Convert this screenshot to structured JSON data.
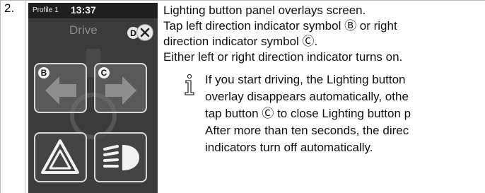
{
  "step": {
    "number": "2."
  },
  "screen": {
    "profile": "Profile 1",
    "time": "13:37",
    "title": "Drive",
    "callouts": {
      "b": "B",
      "c": "C",
      "d": "D"
    },
    "colors": {
      "background": "#3b3b3b",
      "topbar": "#1f1f1f",
      "button_border": "#d9d9d9"
    }
  },
  "instructions": [
    "Lighting button panel overlays screen.",
    "Tap left direction indicator symbol Ⓑ or right",
    "direction indicator symbol Ⓒ.",
    "Either left or right direction indicator turns on."
  ],
  "note": {
    "icon": "info-icon",
    "lines": [
      "If you start driving, the Lighting button",
      "overlay disappears automatically, othe",
      "tap button Ⓒ to close Lighting button p",
      "After more than ten seconds, the direc",
      "indicators turn off automatically."
    ]
  }
}
